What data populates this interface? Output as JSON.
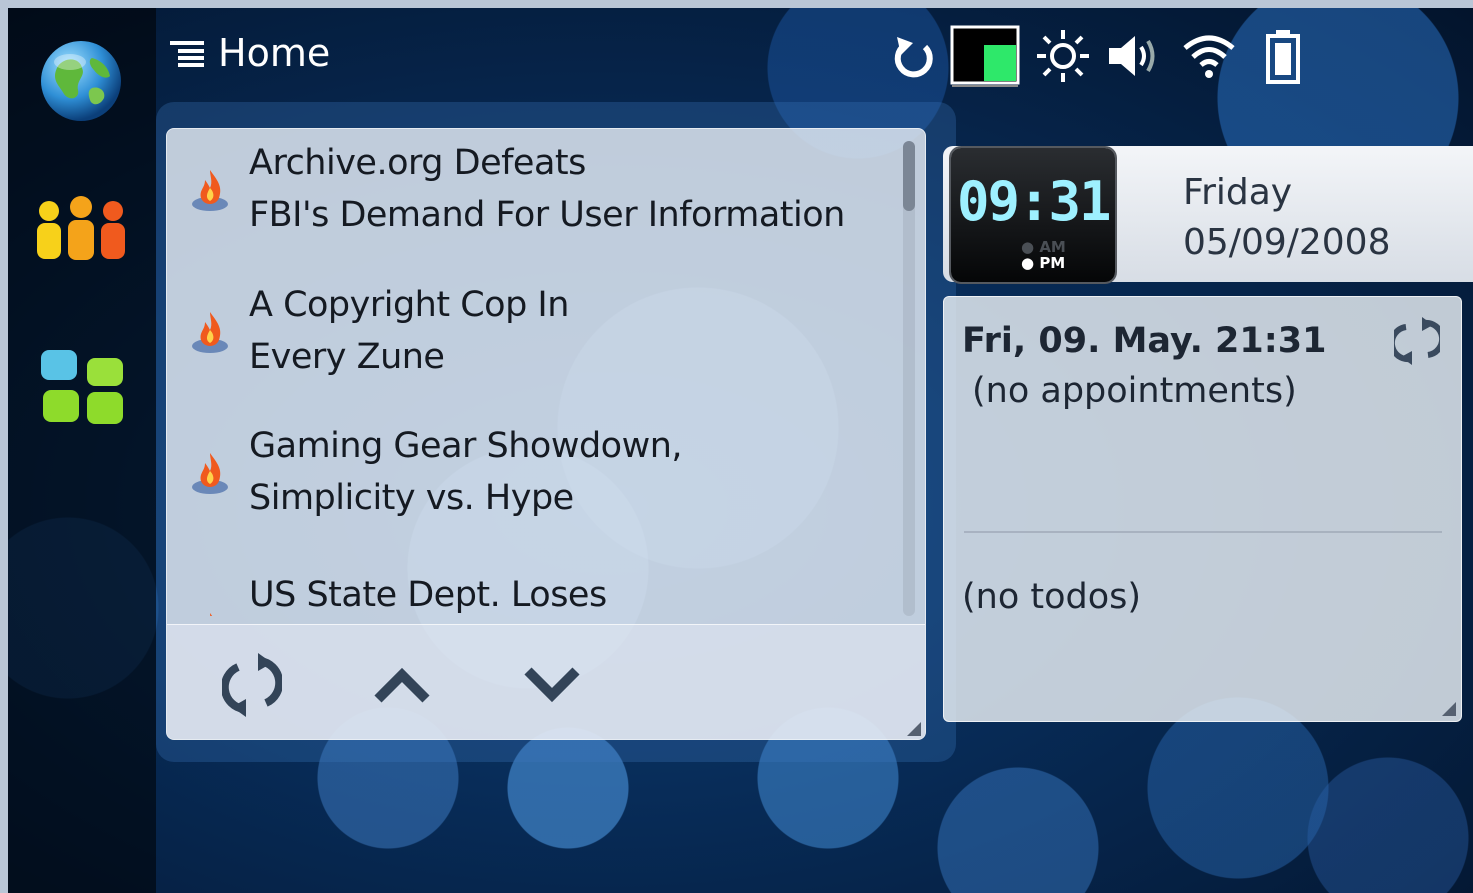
{
  "statusbar": {
    "title": "Home",
    "icons": [
      "menu-icon",
      "refresh-icon",
      "cpu-load-icon",
      "brightness-icon",
      "volume-icon",
      "wifi-icon",
      "battery-icon"
    ]
  },
  "launcher": {
    "items": [
      "web-browser",
      "contacts",
      "applications"
    ]
  },
  "news": {
    "items": [
      {
        "title_line1": "Archive.org Defeats",
        "title_line2": "FBI's Demand For User Information"
      },
      {
        "title_line1": "A Copyright Cop In",
        "title_line2": "Every Zune"
      },
      {
        "title_line1": "Gaming Gear Showdown,",
        "title_line2": "Simplicity vs. Hype"
      },
      {
        "title_line1": "US State Dept. Loses",
        "title_line2": ""
      }
    ],
    "toolbar": [
      "refresh",
      "previous",
      "next"
    ]
  },
  "clock": {
    "time": "09:31",
    "am": "AM",
    "pm": "PM",
    "day": "Friday",
    "date": "05/09/2008"
  },
  "calendar": {
    "date_heading": "Fri, 09. May. 21:31",
    "appointments": "(no appointments)",
    "todos": "(no todos)"
  },
  "colors": {
    "clock_digits": "#9ef0ff",
    "cpu_load": "#2ee86a",
    "feed_orange": "#f05a1e"
  }
}
